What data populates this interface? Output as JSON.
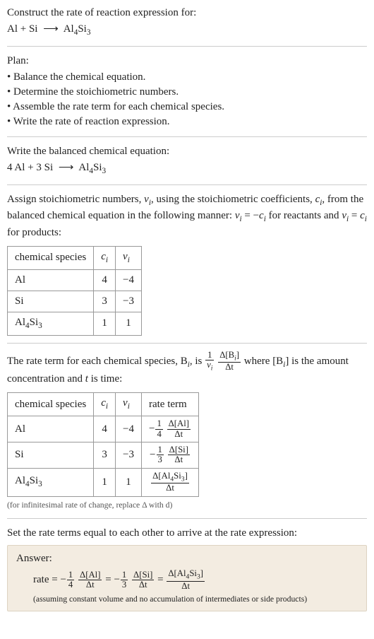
{
  "intro": {
    "title": "Construct the rate of reaction expression for:",
    "unbalanced_lhs1": "Al + Si",
    "arrow": "⟶",
    "unbalanced_rhs": "Al",
    "unbalanced_rhs_sub1": "4",
    "unbalanced_rhs2": "Si",
    "unbalanced_rhs_sub2": "3"
  },
  "plan": {
    "heading": "Plan:",
    "b1": "• Balance the chemical equation.",
    "b2": "• Determine the stoichiometric numbers.",
    "b3": "• Assemble the rate term for each chemical species.",
    "b4": "• Write the rate of reaction expression."
  },
  "balanced": {
    "heading": "Write the balanced chemical equation:",
    "lhs": "4 Al + 3 Si",
    "arrow": "⟶",
    "rhs1": "Al",
    "rhs_sub1": "4",
    "rhs2": "Si",
    "rhs_sub2": "3"
  },
  "stoich": {
    "text1": "Assign stoichiometric numbers, ",
    "nu_i": "ν",
    "sub_i": "i",
    "text2": ", using the stoichiometric coefficients, ",
    "c_i": "c",
    "text3": ", from the balanced chemical equation in the following manner: ",
    "eq1_lhs": "ν",
    "eq1_eq": " = −",
    "eq1_rhs": "c",
    "text4": " for reactants and ",
    "eq2": " = ",
    "text5": " for products:"
  },
  "table1": {
    "h1": "chemical species",
    "h2": "c",
    "h2sub": "i",
    "h3": "ν",
    "h3sub": "i",
    "r1c1": "Al",
    "r1c2": "4",
    "r1c3": "−4",
    "r2c1": "Si",
    "r2c2": "3",
    "r2c3": "−3",
    "r3c1a": "Al",
    "r3c1sub1": "4",
    "r3c1b": "Si",
    "r3c1sub2": "3",
    "r3c2": "1",
    "r3c3": "1"
  },
  "rateterm": {
    "text1": "The rate term for each chemical species, B",
    "sub_i": "i",
    "text2": ", is ",
    "one": "1",
    "nu_i": "ν",
    "delta": "Δ[B",
    "delta_close": "]",
    "dt": "Δt",
    "text3": " where [B",
    "text4": "] is the amount concentration and ",
    "t": "t",
    "text5": " is time:"
  },
  "table2": {
    "h1": "chemical species",
    "h2": "c",
    "h2sub": "i",
    "h3": "ν",
    "h3sub": "i",
    "h4": "rate term",
    "r1c1": "Al",
    "r1c2": "4",
    "r1c3": "−4",
    "r1_minus": "−",
    "r1_fnum": "1",
    "r1_fden": "4",
    "r1_dnum": "Δ[Al]",
    "r1_dden": "Δt",
    "r2c1": "Si",
    "r2c2": "3",
    "r2c3": "−3",
    "r2_minus": "−",
    "r2_fnum": "1",
    "r2_fden": "3",
    "r2_dnum": "Δ[Si]",
    "r2_dden": "Δt",
    "r3c1a": "Al",
    "r3c1sub1": "4",
    "r3c1b": "Si",
    "r3c1sub2": "3",
    "r3c2": "1",
    "r3c3": "1",
    "r3_dnum_a": "Δ[Al",
    "r3_dnum_sub1": "4",
    "r3_dnum_b": "Si",
    "r3_dnum_sub2": "3",
    "r3_dnum_c": "]",
    "r3_dden": "Δt"
  },
  "note": "(for infinitesimal rate of change, replace Δ with d)",
  "final_heading": "Set the rate terms equal to each other to arrive at the rate expression:",
  "answer": {
    "label": "Answer:",
    "rate": "rate = −",
    "f1num": "1",
    "f1den": "4",
    "d1num": "Δ[Al]",
    "d1den": "Δt",
    "eqs": " = −",
    "f2num": "1",
    "f2den": "3",
    "d2num": "Δ[Si]",
    "d2den": "Δt",
    "eqs2": " = ",
    "d3num_a": "Δ[Al",
    "d3num_sub1": "4",
    "d3num_b": "Si",
    "d3num_sub2": "3",
    "d3num_c": "]",
    "d3den": "Δt",
    "assume": "(assuming constant volume and no accumulation of intermediates or side products)"
  },
  "chart_data": {
    "type": "table",
    "title": "Stoichiometric numbers and rate terms for 4 Al + 3 Si ⟶ Al4Si3",
    "columns": [
      "chemical species",
      "c_i",
      "ν_i",
      "rate term"
    ],
    "rows": [
      {
        "species": "Al",
        "c_i": 4,
        "nu_i": -4,
        "rate_term": "-(1/4) Δ[Al]/Δt"
      },
      {
        "species": "Si",
        "c_i": 3,
        "nu_i": -3,
        "rate_term": "-(1/3) Δ[Si]/Δt"
      },
      {
        "species": "Al4Si3",
        "c_i": 1,
        "nu_i": 1,
        "rate_term": "Δ[Al4Si3]/Δt"
      }
    ],
    "rate_expression": "rate = -(1/4) Δ[Al]/Δt = -(1/3) Δ[Si]/Δt = Δ[Al4Si3]/Δt"
  }
}
